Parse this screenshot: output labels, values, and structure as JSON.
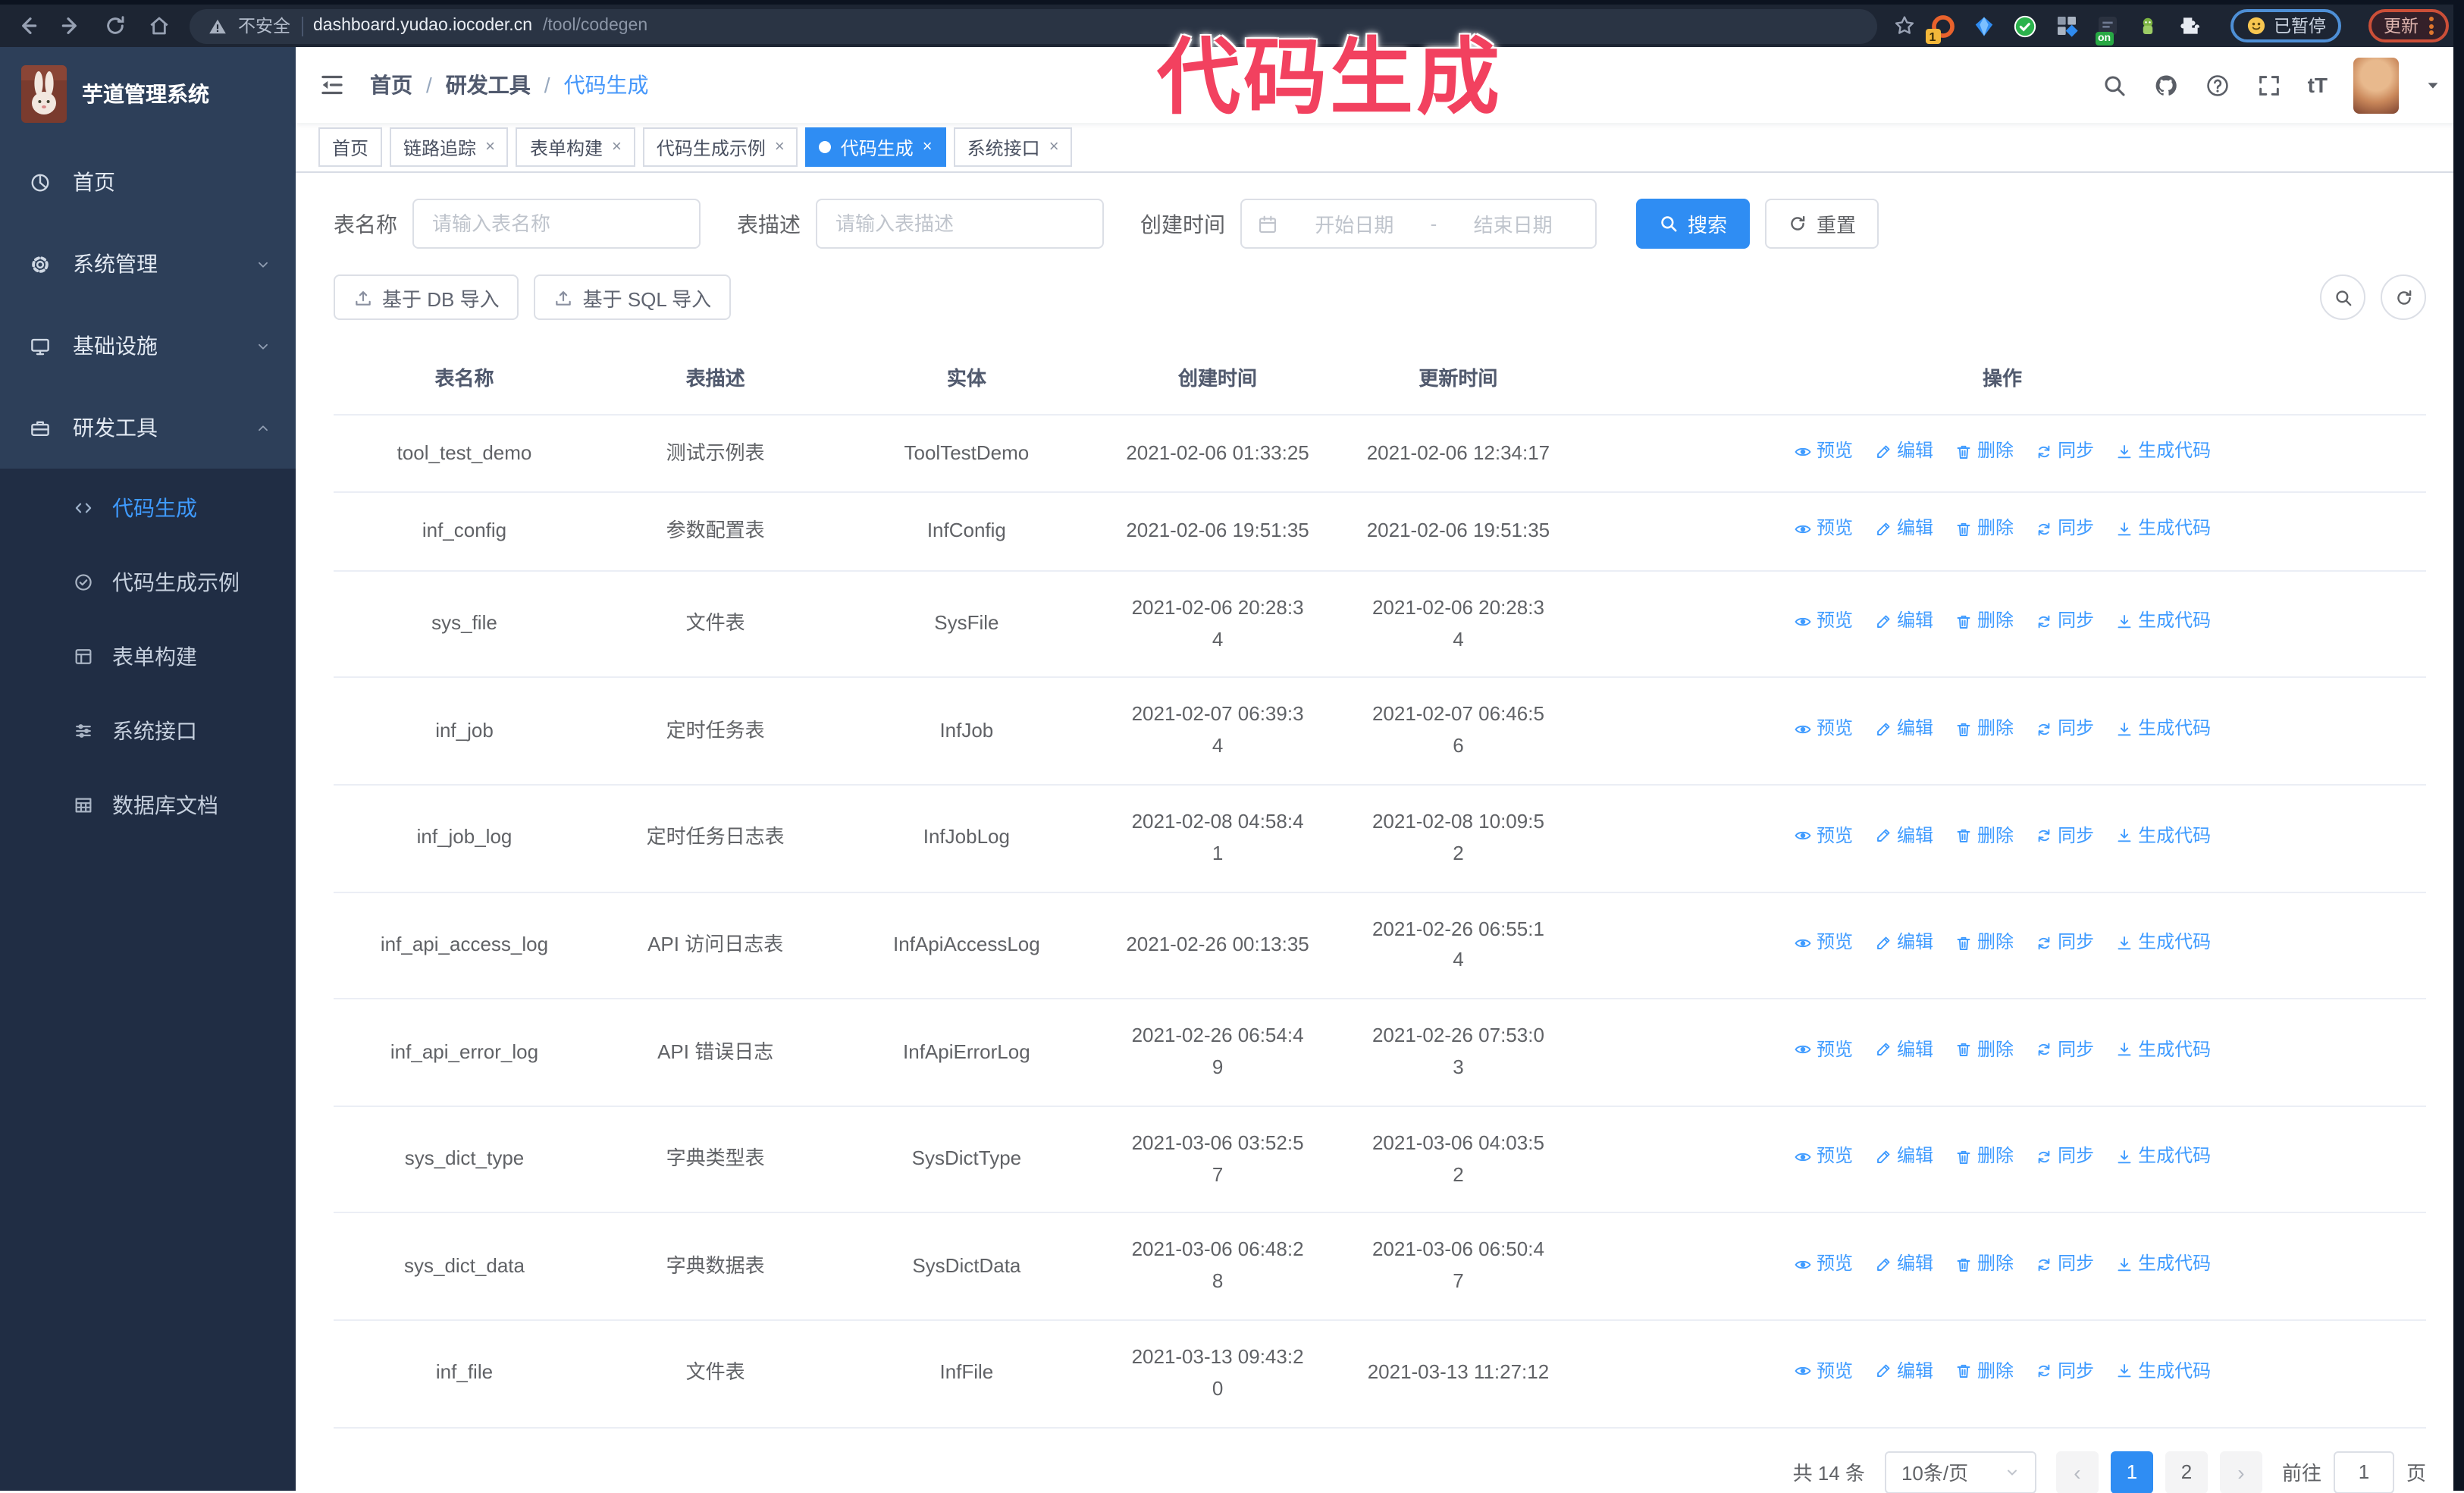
{
  "browser": {
    "security_label": "不安全",
    "url_host": "dashboard.yudao.iocoder.cn",
    "url_path": "/tool/codegen",
    "extension_badge": "1",
    "extension_on_badge": "on",
    "paused_badge": "已暂停",
    "update_badge": "更新"
  },
  "overlay": {
    "text": "代码生成",
    "color": "#f2415f"
  },
  "sidebar": {
    "title": "芋道管理系统",
    "items": [
      {
        "label": "首页",
        "icon": "dashboard",
        "chevron": ""
      },
      {
        "label": "系统管理",
        "icon": "gear",
        "chevron": "down"
      },
      {
        "label": "基础设施",
        "icon": "monitor",
        "chevron": "down"
      },
      {
        "label": "研发工具",
        "icon": "toolbox",
        "chevron": "up"
      }
    ],
    "subitems": [
      {
        "label": "代码生成",
        "icon": "code",
        "active": true
      },
      {
        "label": "代码生成示例",
        "icon": "example",
        "active": false
      },
      {
        "label": "表单构建",
        "icon": "form",
        "active": false
      },
      {
        "label": "系统接口",
        "icon": "api",
        "active": false
      },
      {
        "label": "数据库文档",
        "icon": "dbdoc",
        "active": false
      }
    ]
  },
  "navbar": {
    "breadcrumb": [
      "首页",
      "研发工具",
      "代码生成"
    ]
  },
  "tags": [
    {
      "label": "首页",
      "closable": false,
      "active": false
    },
    {
      "label": "链路追踪",
      "closable": true,
      "active": false
    },
    {
      "label": "表单构建",
      "closable": true,
      "active": false
    },
    {
      "label": "代码生成示例",
      "closable": true,
      "active": false
    },
    {
      "label": "代码生成",
      "closable": true,
      "active": true
    },
    {
      "label": "系统接口",
      "closable": true,
      "active": false
    }
  ],
  "search": {
    "name_label": "表名称",
    "name_placeholder": "请输入表名称",
    "desc_label": "表描述",
    "desc_placeholder": "请输入表描述",
    "time_label": "创建时间",
    "start_placeholder": "开始日期",
    "range_separator": "-",
    "end_placeholder": "结束日期",
    "search_button": "搜索",
    "reset_button": "重置"
  },
  "toolbar": {
    "db_import": "基于 DB 导入",
    "sql_import": "基于 SQL 导入"
  },
  "table": {
    "columns": [
      "表名称",
      "表描述",
      "实体",
      "创建时间",
      "更新时间",
      "操作"
    ],
    "actions": [
      "预览",
      "编辑",
      "删除",
      "同步",
      "生成代码"
    ],
    "rows": [
      {
        "name": "tool_test_demo",
        "desc": "测试示例表",
        "entity": "ToolTestDemo",
        "created": "2021-02-06 01:33:25",
        "updated": "2021-02-06 12:34:17"
      },
      {
        "name": "inf_config",
        "desc": "参数配置表",
        "entity": "InfConfig",
        "created": "2021-02-06 19:51:35",
        "updated": "2021-02-06 19:51:35"
      },
      {
        "name": "sys_file",
        "desc": "文件表",
        "entity": "SysFile",
        "created": "2021-02-06 20:28:3\n4",
        "updated": "2021-02-06 20:28:3\n4"
      },
      {
        "name": "inf_job",
        "desc": "定时任务表",
        "entity": "InfJob",
        "created": "2021-02-07 06:39:3\n4",
        "updated": "2021-02-07 06:46:5\n6"
      },
      {
        "name": "inf_job_log",
        "desc": "定时任务日志表",
        "entity": "InfJobLog",
        "created": "2021-02-08 04:58:4\n1",
        "updated": "2021-02-08 10:09:5\n2"
      },
      {
        "name": "inf_api_access_log",
        "desc": "API 访问日志表",
        "entity": "InfApiAccessLog",
        "created": "2021-02-26 00:13:35",
        "updated": "2021-02-26 06:55:1\n4"
      },
      {
        "name": "inf_api_error_log",
        "desc": "API 错误日志",
        "entity": "InfApiErrorLog",
        "created": "2021-02-26 06:54:4\n9",
        "updated": "2021-02-26 07:53:0\n3"
      },
      {
        "name": "sys_dict_type",
        "desc": "字典类型表",
        "entity": "SysDictType",
        "created": "2021-03-06 03:52:5\n7",
        "updated": "2021-03-06 04:03:5\n2"
      },
      {
        "name": "sys_dict_data",
        "desc": "字典数据表",
        "entity": "SysDictData",
        "created": "2021-03-06 06:48:2\n8",
        "updated": "2021-03-06 06:50:4\n7"
      },
      {
        "name": "inf_file",
        "desc": "文件表",
        "entity": "InfFile",
        "created": "2021-03-13 09:43:2\n0",
        "updated": "2021-03-13 11:27:12"
      }
    ]
  },
  "pagination": {
    "total": "共 14 条",
    "page_size": "10条/页",
    "pages": [
      "1",
      "2"
    ],
    "active_page": "1",
    "goto_label": "前往",
    "goto_value": "1",
    "page_unit": "页"
  }
}
